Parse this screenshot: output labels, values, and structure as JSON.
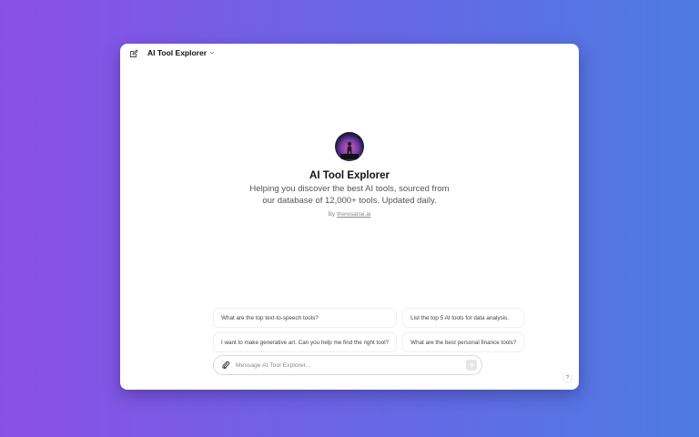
{
  "header": {
    "model_name": "AI Tool Explorer",
    "edit_icon": "edit-icon",
    "chevron_icon": "chevron-down-icon"
  },
  "hero": {
    "title": "AI Tool Explorer",
    "description": "Helping you discover the best AI tools, sourced from our database of 12,000+ tools. Updated daily.",
    "by_prefix": "By",
    "author": "theresanai.ai"
  },
  "suggestions": [
    "What are the top text-to-speech tools?",
    "List the top 5 AI tools for data analysis.",
    "I want to make generative art. Can you help me find the right tool?",
    "What are the best personal finance tools?"
  ],
  "composer": {
    "placeholder": "Message AI Tool Explorer...",
    "attach_icon": "paperclip-icon",
    "send_icon": "arrow-up-icon"
  },
  "help": {
    "label": "?"
  },
  "colors": {
    "background_start": "#8c4fe6",
    "background_end": "#4d7be2",
    "window": "#ffffff"
  }
}
